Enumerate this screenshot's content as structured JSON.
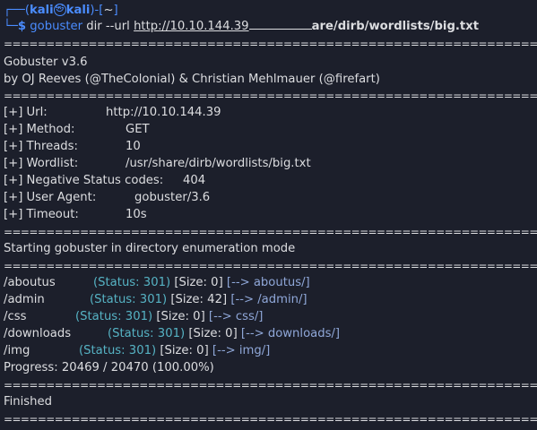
{
  "prompt": {
    "user": "kali",
    "host": "kali",
    "cwd": "~",
    "symbol": "$",
    "command": "gobuster",
    "args": "dir --url",
    "url": "http://10.10.144.39",
    "wordlist_tail": "are/dirb/wordlists/big.txt"
  },
  "separator": "===============================================================",
  "banner": {
    "version": "Gobuster v3.6",
    "credits": "by OJ Reeves (@TheColonial) & Christian Mehlmauer (@firefart)"
  },
  "config": [
    {
      "key": "[+] Url:",
      "value": "http://10.10.144.39"
    },
    {
      "key": "[+] Method:",
      "value": "GET"
    },
    {
      "key": "[+] Threads:",
      "value": "10"
    },
    {
      "key": "[+] Wordlist:",
      "value": "/usr/share/dirb/wordlists/big.txt"
    },
    {
      "key": "[+] Negative Status codes:",
      "value": "404"
    },
    {
      "key": "[+] User Agent:",
      "value": "gobuster/3.6"
    },
    {
      "key": "[+] Timeout:",
      "value": "10s"
    }
  ],
  "mode_text": "Starting gobuster in directory enumeration mode",
  "results": [
    {
      "path": "/aboutus",
      "status": "(Status: 301)",
      "size": "[Size: 0]",
      "redirect": "[--> aboutus/]"
    },
    {
      "path": "/admin",
      "status": "(Status: 301)",
      "size": "[Size: 42]",
      "redirect": "[--> /admin/]"
    },
    {
      "path": "/css",
      "status": "(Status: 301)",
      "size": "[Size: 0]",
      "redirect": "[--> css/]"
    },
    {
      "path": "/downloads",
      "status": "(Status: 301)",
      "size": "[Size: 0]",
      "redirect": "[--> downloads/]"
    },
    {
      "path": "/img",
      "status": "(Status: 301)",
      "size": "[Size: 0]",
      "redirect": "[--> img/]"
    }
  ],
  "progress": "Progress: 20469 / 20470 (100.00%)",
  "finished": "Finished",
  "colors": {
    "background": "#1c1f2b",
    "prompt_blue": "#4a8cff",
    "status_cyan": "#56b3c4",
    "redirect": "#8fa7d8",
    "text": "#dcdde0"
  }
}
